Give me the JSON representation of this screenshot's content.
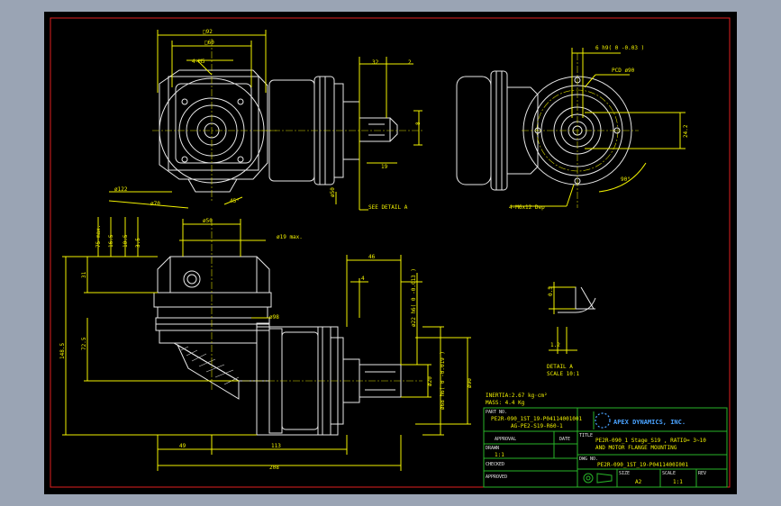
{
  "dims": {
    "sq92": "□92",
    "sq60": "□60",
    "m5": "4-M5",
    "d32": "32",
    "d2": "2",
    "d8": "8",
    "d19": "19",
    "d122": "ø122",
    "d70": "ø70",
    "a45": "45°",
    "d50": "ø50",
    "see_detail": "SEE DETAIL A",
    "h6": "6 h9( 0 -0.03 )",
    "pcd": "PCD ø90",
    "d242": "24.2",
    "a90": "90°",
    "m6": "4-M6x12 Dep",
    "d50b": "ø50",
    "max75": "75 max.",
    "d165": "16.5",
    "d105": "10.5",
    "d35": "3.5",
    "d19max": "ø19 max.",
    "d31": "31",
    "d46": "46",
    "d4": "4",
    "d22": "ø22 h6( 0 -0.013 )",
    "d725": "72.5",
    "d1485": "148.5",
    "d98": "ø98",
    "d20": "ø20",
    "d68": "ø68 h6( 0 -0.019 )",
    "d90": "ø90",
    "d05": "0.5",
    "d12": "1.2",
    "d49": "49",
    "d113": "113",
    "d208": "208"
  },
  "detail": {
    "label": "DETAIL A",
    "scale": "SCALE 10:1"
  },
  "specs": {
    "inertia": "INERTIA:2.67 kg·cm²",
    "mass": "MASS: 4.4 Kg"
  },
  "title_block": {
    "part_no_label": "PART NO.",
    "part_no_1": "PE2R-090_1ST_19-P04114001001",
    "part_no_2": "AG-PE2-S19-R60-1",
    "approval_label": "APPROVAL",
    "date_label": "DATE",
    "drawn_label": "DRAWN",
    "drawn_value": "1:1",
    "checked_label": "CHECKED",
    "approved_label": "APPROVED",
    "company": "APEX DYNAMICS, INC.",
    "title_label": "TITLE",
    "title_1": "PE2R-090_1 Stage_S19 , RATIO= 3~10",
    "title_2": "AND MOTOR FLANGE MOUNTING",
    "dwg_label": "DWG NO.",
    "dwg_no": "PE2R-090_1ST_19-P0411400I001",
    "size_label": "SIZE",
    "size": "A2",
    "scale_label": "SCALE",
    "scale": "1:1",
    "rev_label": "REV"
  },
  "colors": {
    "background": "#000000",
    "frame": "#e02020",
    "lines": "#f2f200",
    "outline": "#e8e8e8",
    "hidden": "#7a7a7a",
    "title_block": "#28b428",
    "logo": "#4aa3ff"
  }
}
